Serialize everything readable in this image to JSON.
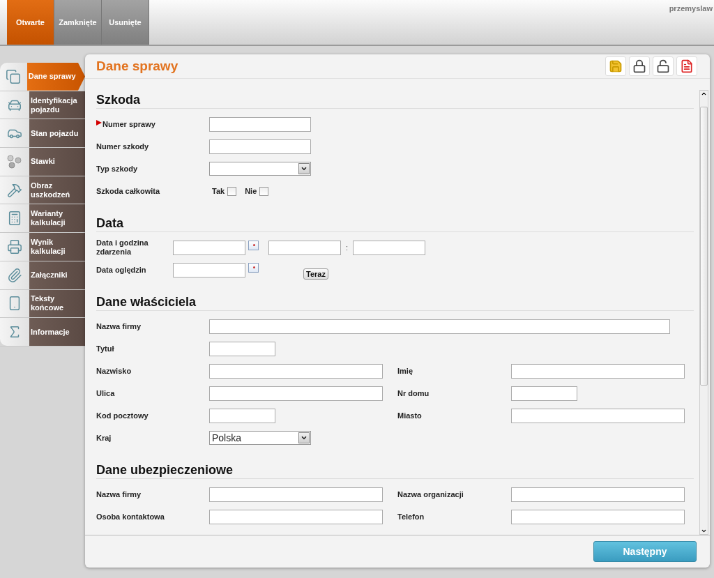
{
  "tabs": [
    {
      "label": "Otwarte",
      "selected": true
    },
    {
      "label": "Zamknięte",
      "selected": false
    },
    {
      "label": "Usunięte",
      "selected": false
    }
  ],
  "user": "przemyslaw",
  "sidebar": {
    "items": [
      {
        "label": "Dane sprawy",
        "selected": true
      },
      {
        "label": "Identyfikacja pojazdu",
        "selected": false
      },
      {
        "label": "Stan pojazdu",
        "selected": false
      },
      {
        "label": "Stawki",
        "selected": false
      },
      {
        "label": "Obraz uszkodzeń",
        "selected": false
      },
      {
        "label": "Warianty kalkulacji",
        "selected": false
      },
      {
        "label": "Wynik kalkulacji",
        "selected": false
      },
      {
        "label": "Załączniki",
        "selected": false
      },
      {
        "label": "Teksty końcowe",
        "selected": false
      },
      {
        "label": "Informacje",
        "selected": false
      }
    ]
  },
  "panel": {
    "title": "Dane sprawy",
    "sections": [
      {
        "title": "Szkoda",
        "rows": [
          {
            "fields": [
              {
                "kind": "text",
                "label": "Numer sprawy",
                "required": true
              }
            ]
          },
          {
            "fields": [
              {
                "kind": "text",
                "label": "Numer szkody",
                "required": false
              }
            ]
          },
          {
            "fields": [
              {
                "kind": "select",
                "label": "Typ szkody",
                "required": false
              }
            ]
          },
          {
            "fields": [
              {
                "kind": "checks",
                "label": "Szkoda całkowita",
                "required": false,
                "options": [
                  {
                    "label": "Tak",
                    "checked": false
                  },
                  {
                    "label": "Nie",
                    "checked": false
                  }
                ]
              }
            ]
          }
        ]
      },
      {
        "title": "Data",
        "rows": [
          {
            "fields": [
              {
                "kind": "datetime",
                "label": "Data i godzina zdarzenia",
                "separator": ":",
                "required": false
              }
            ]
          },
          {
            "fields": [
              {
                "kind": "date",
                "label": "Data oględzin",
                "button": "Teraz",
                "required": false
              }
            ]
          }
        ]
      },
      {
        "title": "Dane właściciela",
        "rows": [
          {
            "fields": [
              {
                "kind": "wide",
                "label": "Nazwa firmy",
                "required": false
              }
            ]
          },
          {
            "fields": [
              {
                "kind": "short",
                "label": "Tytuł",
                "required": false
              }
            ]
          },
          {
            "fields": [
              {
                "kind": "long",
                "label": "Nazwisko",
                "required": false
              },
              {
                "kind": "long",
                "label": "Imię",
                "required": false
              }
            ]
          },
          {
            "fields": [
              {
                "kind": "long",
                "label": "Ulica",
                "required": false
              },
              {
                "kind": "short",
                "label": "Nr domu",
                "required": false
              }
            ]
          },
          {
            "fields": [
              {
                "kind": "short",
                "label": "Kod pocztowy",
                "required": false
              },
              {
                "kind": "long",
                "label": "Miasto",
                "required": false
              }
            ]
          },
          {
            "fields": [
              {
                "kind": "select",
                "label": "Kraj",
                "value": "Polska",
                "required": false
              }
            ]
          }
        ]
      },
      {
        "title": "Dane ubezpieczeniowe",
        "rows": [
          {
            "fields": [
              {
                "kind": "long",
                "label": "Nazwa firmy",
                "required": false
              },
              {
                "kind": "long",
                "label": "Nazwa organizacji",
                "required": false
              }
            ]
          },
          {
            "fields": [
              {
                "kind": "long",
                "label": "Osoba kontaktowa",
                "required": false
              },
              {
                "kind": "long",
                "label": "Telefon",
                "required": false
              }
            ]
          }
        ]
      }
    ]
  },
  "footer": {
    "next_button": "Następny"
  }
}
